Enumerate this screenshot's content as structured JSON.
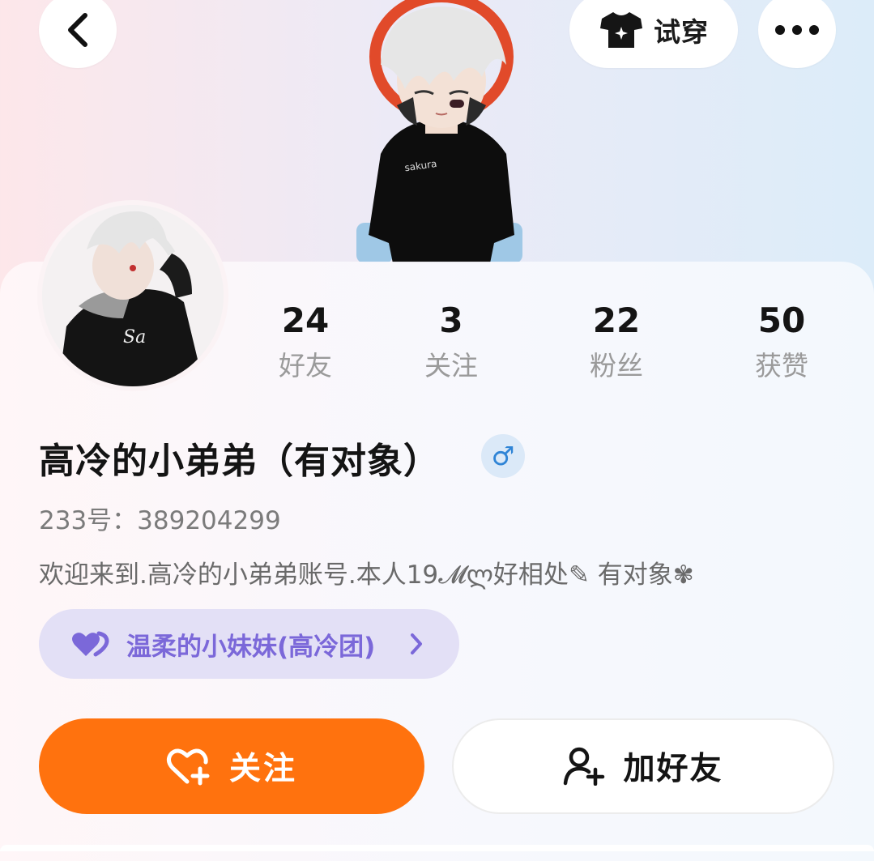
{
  "header": {
    "try_on_label": "试穿",
    "icons": {
      "back": "back-chevron-icon",
      "tshirt": "tshirt-icon",
      "more": "more-dots-icon"
    }
  },
  "stats": [
    {
      "value": "24",
      "label": "好友"
    },
    {
      "value": "3",
      "label": "关注"
    },
    {
      "value": "22",
      "label": "粉丝"
    },
    {
      "value": "50",
      "label": "获赞"
    }
  ],
  "profile": {
    "name": "高冷的小弟弟（有对象）",
    "gender_symbol": "♂",
    "uid": "233号：389204299",
    "bio": "欢迎来到.高冷的小弟弟账号.本人19𝓜ლ好相处✎ 有对象✾"
  },
  "group": {
    "label": "温柔的小妹妹(高冷团)",
    "icon": "double-heart-icon"
  },
  "actions": {
    "follow_label": "关注",
    "add_friend_label": "加好友"
  },
  "colors": {
    "accent_orange": "#ff720e",
    "group_purple": "#7b68d9",
    "gender_blue": "#2f84d6"
  }
}
